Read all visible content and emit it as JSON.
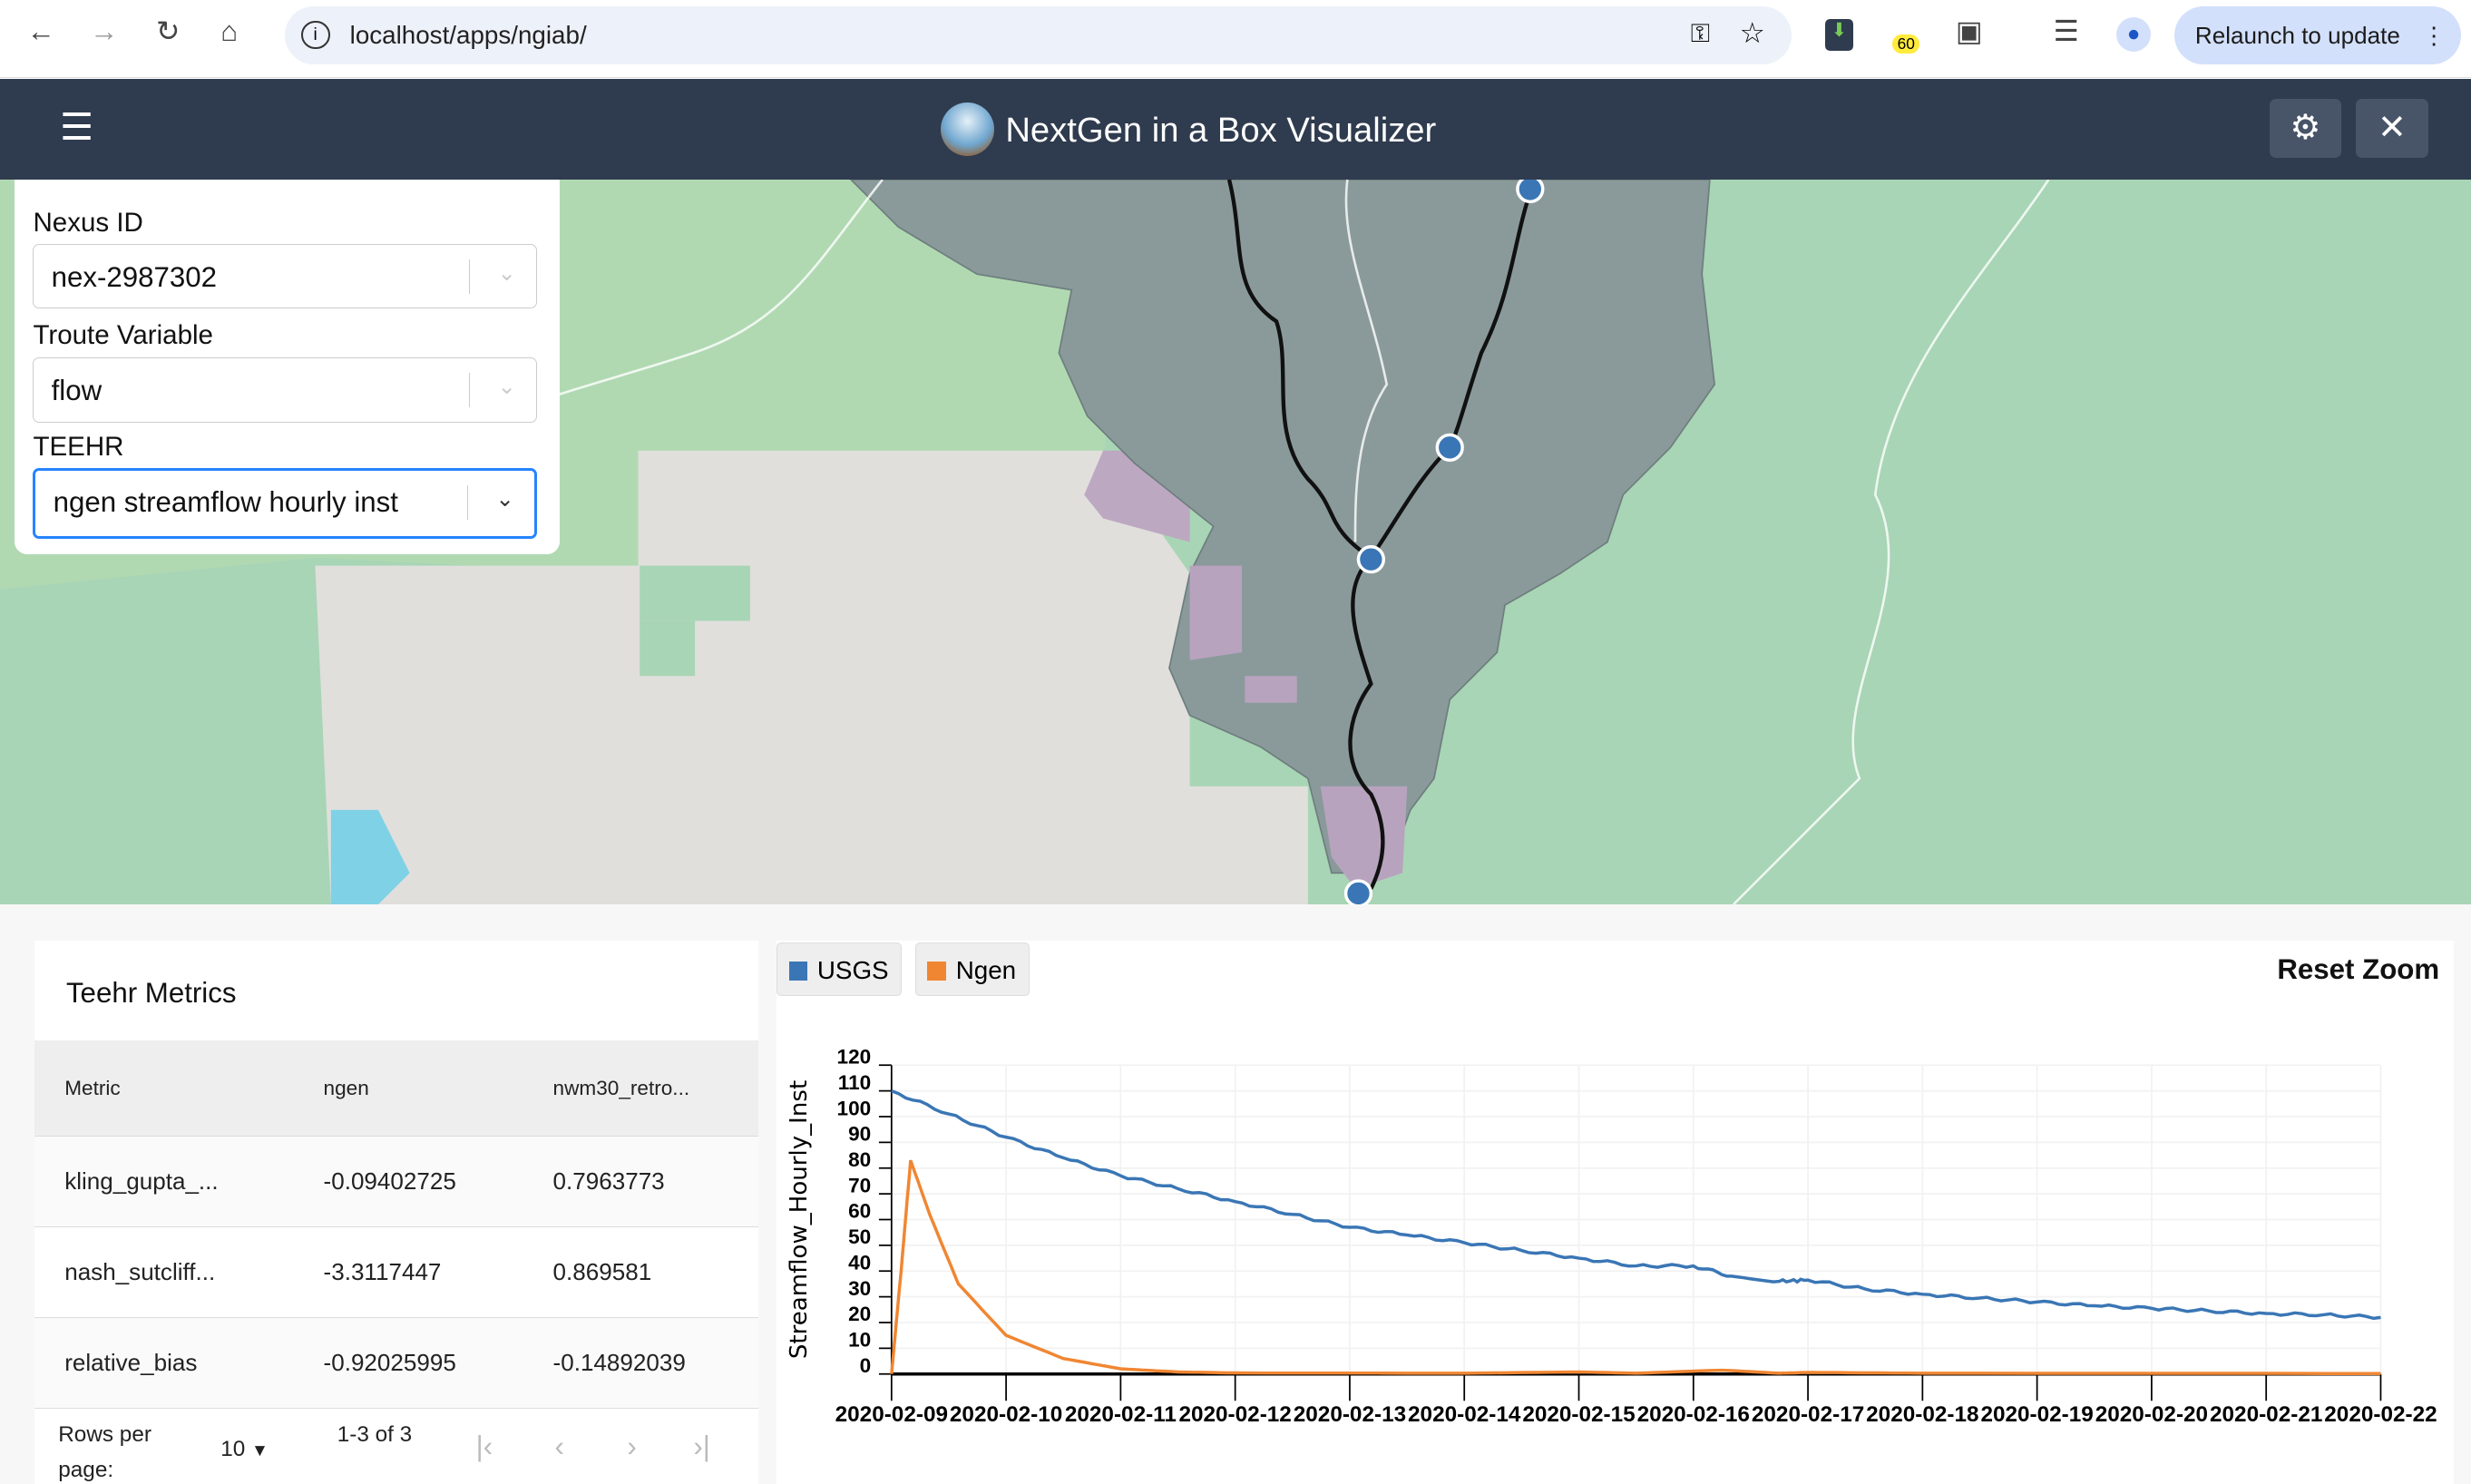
{
  "browser": {
    "url": "localhost/apps/ngiab/",
    "relaunch_label": "Relaunch to update",
    "extension_badge": "60"
  },
  "app": {
    "title": "NextGen in a Box Visualizer"
  },
  "filters": {
    "nexus_label": "Nexus ID",
    "nexus_value": "nex-2987302",
    "troute_label": "Troute Variable",
    "troute_value": "flow",
    "teehr_label": "TEEHR",
    "teehr_value": "ngen streamflow hourly inst"
  },
  "metrics": {
    "title": "Teehr Metrics",
    "columns": [
      "Metric",
      "ngen",
      "nwm30_retro..."
    ],
    "rows": [
      [
        "kling_gupta_...",
        "-0.09402725",
        "0.7963773"
      ],
      [
        "nash_sutcliff...",
        "-3.3117447",
        "0.869581"
      ],
      [
        "relative_bias",
        "-0.92025995",
        "-0.14892039"
      ]
    ],
    "rows_per_page_label": "Rows per page:",
    "rows_per_page": "10",
    "range": "1-3 of 3"
  },
  "chart_toolbar": {
    "reset_zoom": "Reset Zoom"
  },
  "chart_data": {
    "type": "line",
    "ylabel": "Streamflow_Hourly_Inst",
    "xlabel": "",
    "ylim": [
      0,
      120
    ],
    "yticks": [
      0,
      10,
      20,
      30,
      40,
      50,
      60,
      70,
      80,
      90,
      100,
      110,
      120
    ],
    "xticks": [
      "2020-02-09",
      "2020-02-10",
      "2020-02-11",
      "2020-02-12",
      "2020-02-13",
      "2020-02-14",
      "2020-02-15",
      "2020-02-16",
      "2020-02-17",
      "2020-02-18",
      "2020-02-19",
      "2020-02-20",
      "2020-02-21",
      "2020-02-22"
    ],
    "grid": true,
    "legend": "top-left",
    "series": [
      {
        "name": "USGS",
        "color": "#3a76b5",
        "points": [
          [
            "2020-02-09T00",
            110
          ],
          [
            "2020-02-09T12",
            101
          ],
          [
            "2020-02-10T00",
            92
          ],
          [
            "2020-02-10T12",
            84
          ],
          [
            "2020-02-11T00",
            77
          ],
          [
            "2020-02-11T12",
            72
          ],
          [
            "2020-02-12T00",
            67
          ],
          [
            "2020-02-12T12",
            62
          ],
          [
            "2020-02-13T00",
            57
          ],
          [
            "2020-02-13T12",
            54
          ],
          [
            "2020-02-14T00",
            51
          ],
          [
            "2020-02-14T12",
            48
          ],
          [
            "2020-02-15T00",
            45
          ],
          [
            "2020-02-15T12",
            42
          ],
          [
            "2020-02-16T00",
            42
          ],
          [
            "2020-02-16T08",
            38
          ],
          [
            "2020-02-16T18",
            36
          ],
          [
            "2020-02-17T00",
            36.5
          ],
          [
            "2020-02-17T12",
            33
          ],
          [
            "2020-02-18T00",
            31
          ],
          [
            "2020-02-18T12",
            29.5
          ],
          [
            "2020-02-19T00",
            28
          ],
          [
            "2020-02-19T12",
            26.5
          ],
          [
            "2020-02-20T00",
            25.5
          ],
          [
            "2020-02-20T12",
            24.5
          ],
          [
            "2020-02-21T00",
            23.5
          ],
          [
            "2020-02-21T12",
            23
          ],
          [
            "2020-02-22T00",
            22
          ]
        ]
      },
      {
        "name": "Ngen",
        "color": "#f08632",
        "points": [
          [
            "2020-02-09T00",
            0
          ],
          [
            "2020-02-09T02",
            40
          ],
          [
            "2020-02-09T04",
            83
          ],
          [
            "2020-02-09T08",
            62
          ],
          [
            "2020-02-09T14",
            35
          ],
          [
            "2020-02-10T00",
            15
          ],
          [
            "2020-02-10T12",
            6
          ],
          [
            "2020-02-11T00",
            2
          ],
          [
            "2020-02-11T12",
            0.8
          ],
          [
            "2020-02-12T00",
            0.4
          ],
          [
            "2020-02-14T00",
            0.3
          ],
          [
            "2020-02-15T00",
            0.8
          ],
          [
            "2020-02-15T12",
            0.3
          ],
          [
            "2020-02-16T06",
            1.5
          ],
          [
            "2020-02-16T18",
            0.3
          ],
          [
            "2020-02-17T00",
            0.6
          ],
          [
            "2020-02-18T00",
            0.3
          ],
          [
            "2020-02-22T00",
            0.2
          ]
        ]
      }
    ]
  }
}
